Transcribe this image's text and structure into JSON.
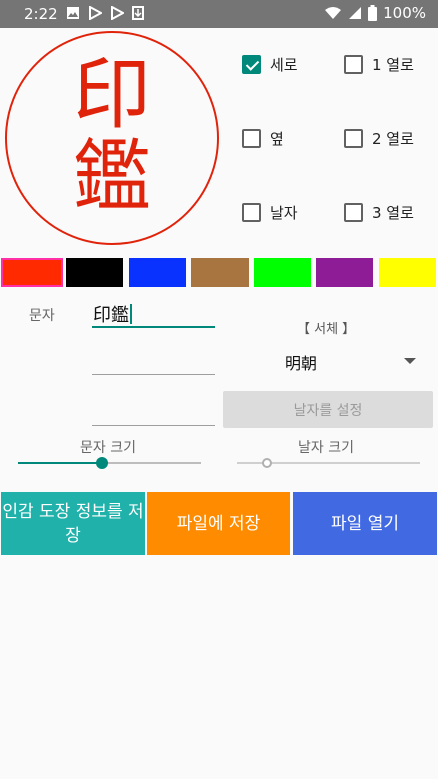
{
  "status_bar": {
    "time": "2:22",
    "battery": "100%"
  },
  "seal": {
    "chars": [
      "印",
      "鑑"
    ],
    "color": "#e0240c"
  },
  "options": {
    "vertical": {
      "label": "세로",
      "checked": true
    },
    "horizontal": {
      "label": "옆",
      "checked": false
    },
    "date": {
      "label": "날자",
      "checked": false
    },
    "col1": {
      "label": "1 열로",
      "checked": false
    },
    "col2": {
      "label": "2 열로",
      "checked": false
    },
    "col3": {
      "label": "3 열로",
      "checked": false
    }
  },
  "colors": [
    "#ff2a00",
    "#000000",
    "#0a32ff",
    "#a87540",
    "#00ff00",
    "#8e1c96",
    "#ffff00"
  ],
  "text_label": "문자",
  "text_value": "印鑑",
  "font_section_label": "【 서체 】",
  "font_value": "明朝",
  "date_button": "날자를 설정",
  "text_size_label": "문자 크기",
  "date_size_label": "날자 크기",
  "text_size_level": 0.46,
  "date_size_level": 0.0,
  "buttons": {
    "save_info": "인감 도장 정보를 저장",
    "save_file": "파일에 저장",
    "open_file": "파일 열기"
  }
}
